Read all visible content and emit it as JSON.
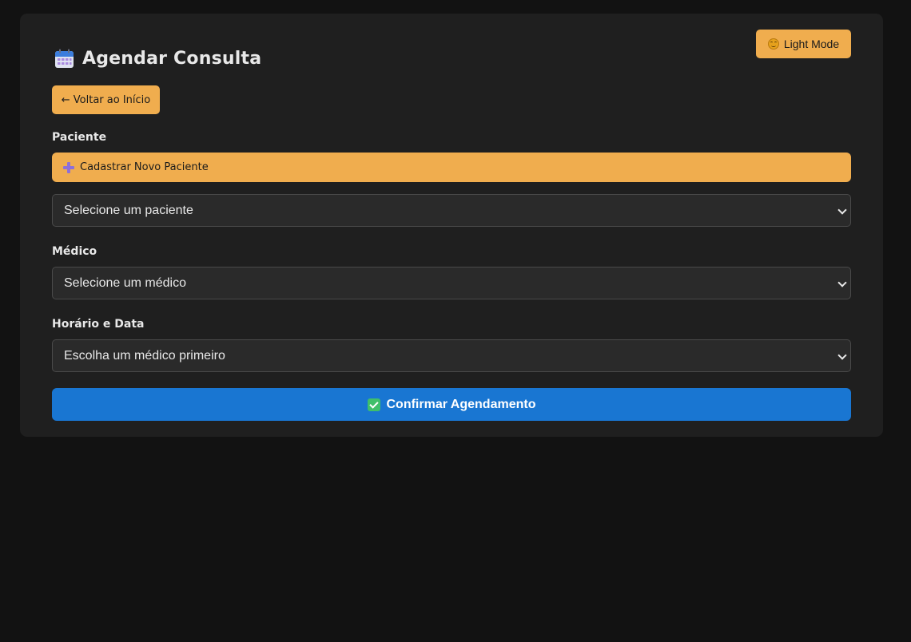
{
  "theme_toggle": {
    "label": "Light Mode",
    "icon": "smiley-icon"
  },
  "header": {
    "title": "Agendar Consulta",
    "icon": "calendar-icon"
  },
  "back_button": {
    "label": "← Voltar ao Início"
  },
  "patient": {
    "label": "Paciente",
    "new_patient_label": "Cadastrar Novo Paciente",
    "select_value": "Selecione um paciente"
  },
  "doctor": {
    "label": "Médico",
    "select_value": "Selecione um médico"
  },
  "schedule": {
    "label": "Horário e Data",
    "select_value": "Escolha um médico primeiro"
  },
  "confirm": {
    "label": "Confirmar Agendamento",
    "icon": "check-icon"
  },
  "colors": {
    "page_bg": "#121212",
    "card_bg": "#1f1f1f",
    "accent_orange": "#f0ad4e",
    "primary_blue": "#1976d2",
    "input_bg": "#2a2a2a"
  }
}
